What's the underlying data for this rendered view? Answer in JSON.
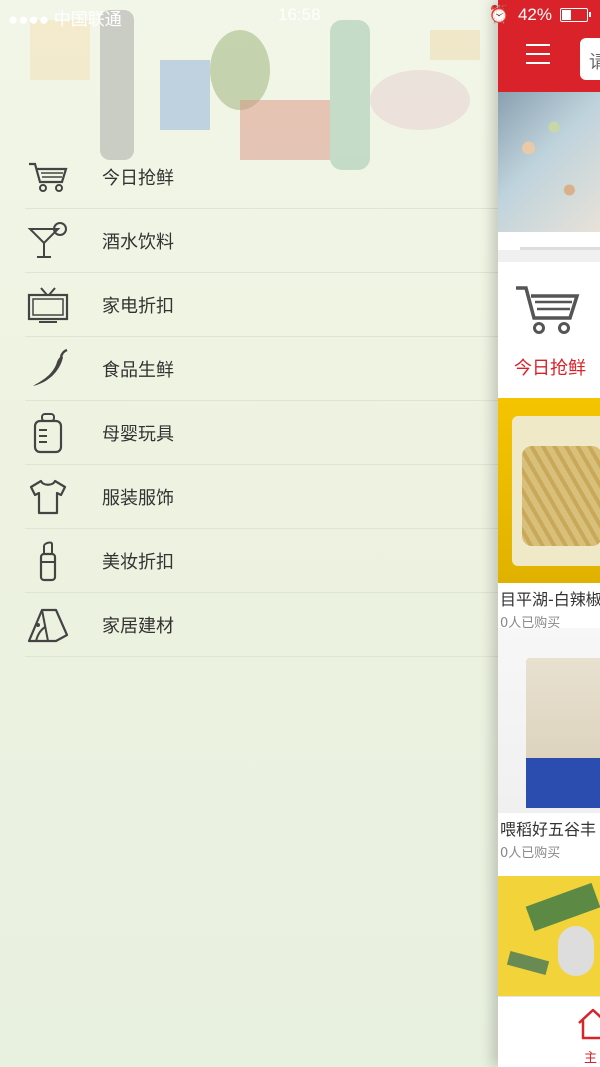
{
  "status_bar": {
    "carrier": "●●●● 中国联通",
    "time": "16:58",
    "battery": "42%",
    "battery_level": 0.42
  },
  "drawer": {
    "menu": [
      {
        "label": "今日抢鲜",
        "icon": "cart-icon"
      },
      {
        "label": "酒水饮料",
        "icon": "cocktail-icon"
      },
      {
        "label": "家电折扣",
        "icon": "tv-icon"
      },
      {
        "label": "食品生鲜",
        "icon": "chili-icon"
      },
      {
        "label": "母婴玩具",
        "icon": "baby-bottle-icon"
      },
      {
        "label": "服装服饰",
        "icon": "tshirt-icon"
      },
      {
        "label": "美妆折扣",
        "icon": "lipstick-icon"
      },
      {
        "label": "家居建材",
        "icon": "tent-icon"
      }
    ]
  },
  "main": {
    "search_placeholder": "请",
    "category_label": "今日抢鲜",
    "products": [
      {
        "title": "目平湖-白辣椒",
        "sold": "0人已购买"
      },
      {
        "title": "喂稻好五谷丰",
        "sold": "0人已购买"
      }
    ],
    "tab_home_label": "主"
  },
  "colors": {
    "accent": "#d9222a",
    "drawer_bg": "#eef3e1"
  }
}
